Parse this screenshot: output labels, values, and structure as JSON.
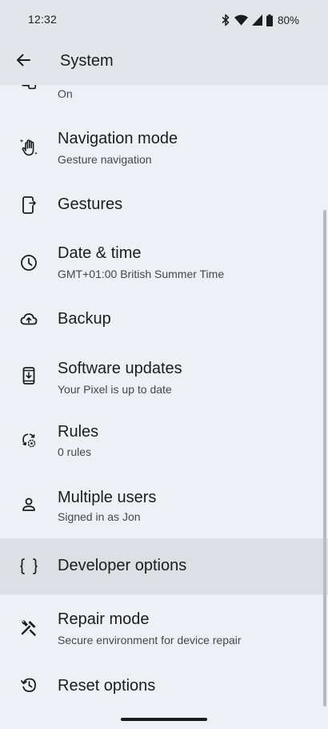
{
  "status_bar": {
    "time": "12:32",
    "battery": "80%",
    "icons": [
      "bluetooth-icon",
      "wifi-icon",
      "signal-icon",
      "battery-icon"
    ]
  },
  "app_bar": {
    "back_icon": "arrow-back-icon",
    "title": "System"
  },
  "items": [
    {
      "icon": "screen-icon",
      "title": "",
      "subtitle": "On"
    },
    {
      "icon": "gesture-hand-icon",
      "title": "Navigation mode",
      "subtitle": "Gesture navigation"
    },
    {
      "icon": "phone-gesture-icon",
      "title": "Gestures",
      "subtitle": ""
    },
    {
      "icon": "clock-icon",
      "title": "Date & time",
      "subtitle": "GMT+01:00 British Summer Time"
    },
    {
      "icon": "cloud-upload-icon",
      "title": "Backup",
      "subtitle": ""
    },
    {
      "icon": "system-update-icon",
      "title": "Software updates",
      "subtitle": "Your Pixel is up to date"
    },
    {
      "icon": "rules-icon",
      "title": "Rules",
      "subtitle": "0 rules"
    },
    {
      "icon": "person-icon",
      "title": "Multiple users",
      "subtitle": "Signed in as Jon"
    },
    {
      "icon": "code-braces-icon",
      "title": "Developer options",
      "subtitle": ""
    },
    {
      "icon": "tools-icon",
      "title": "Repair mode",
      "subtitle": "Secure environment for device repair"
    },
    {
      "icon": "history-icon",
      "title": "Reset options",
      "subtitle": ""
    }
  ],
  "colors": {
    "background": "#EDF1F5",
    "app_bar": "#E2E6EA",
    "highlight": "#DCE0E4",
    "text_primary": "#1B1C1F",
    "text_secondary": "#44474C"
  }
}
